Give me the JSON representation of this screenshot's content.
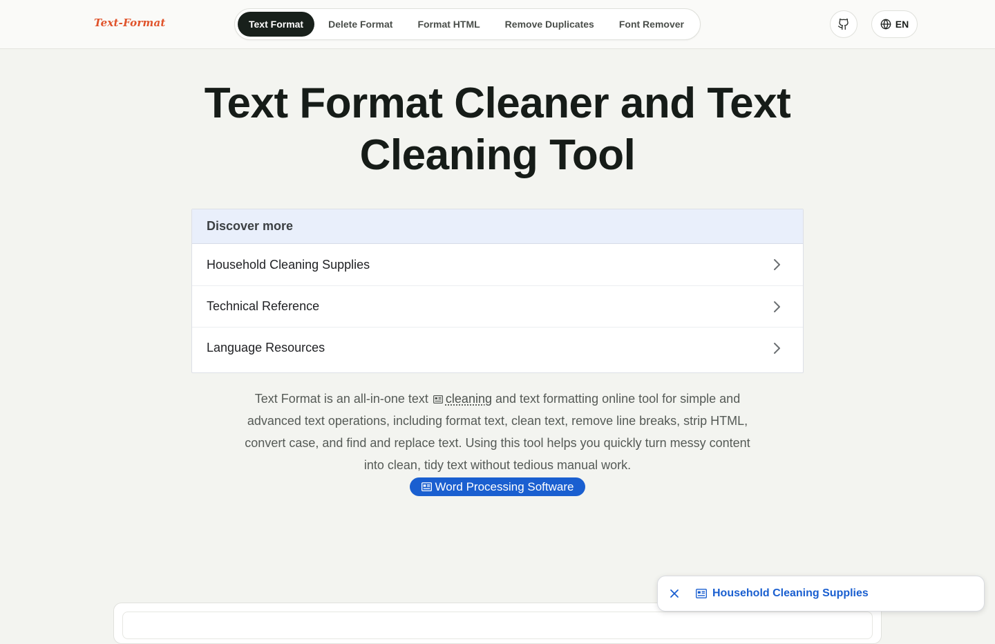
{
  "header": {
    "logo": "Text-Format",
    "nav": [
      {
        "label": "Text Format",
        "active": true
      },
      {
        "label": "Delete Format",
        "active": false
      },
      {
        "label": "Format HTML",
        "active": false
      },
      {
        "label": "Remove Duplicates",
        "active": false
      },
      {
        "label": "Font Remover",
        "active": false
      }
    ],
    "github_icon": "github-icon",
    "language": "EN",
    "language_icon": "globe-icon"
  },
  "hero": {
    "title": "Text Format Cleaner and Text Cleaning Tool"
  },
  "discover": {
    "heading": "Discover more",
    "items": [
      {
        "label": "Household Cleaning Supplies"
      },
      {
        "label": "Technical Reference"
      },
      {
        "label": "Language Resources"
      }
    ],
    "chevron_icon": "chevron-right-icon"
  },
  "description": {
    "before": "Text Format is an all-in-one text",
    "link": "cleaning",
    "after": "and text formatting online tool for simple and advanced text operations, including format text, clean text, remove line breaks, strip HTML, convert case, and find and replace text. Using this tool helps you quickly turn messy content into clean, tidy text without tedious manual work.",
    "chip": "Word Processing Software"
  },
  "float_bar": {
    "close_icon": "close-icon",
    "link": "Household Cleaning Supplies"
  },
  "colors": {
    "accent": "#1a5fd0",
    "logo": "#e0522a",
    "nav_active": "#18201b",
    "background": "#f3f4f0"
  }
}
